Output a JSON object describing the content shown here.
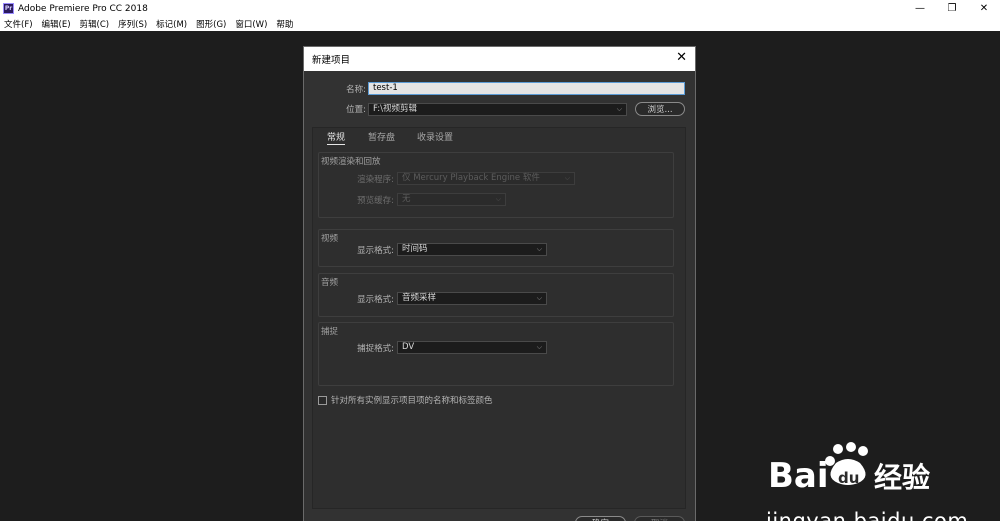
{
  "window": {
    "app_icon": "Pr",
    "title": "Adobe Premiere Pro CC 2018",
    "controls": {
      "minimize": "—",
      "restore": "❐",
      "close": "✕"
    }
  },
  "menu": [
    "文件(F)",
    "编辑(E)",
    "剪辑(C)",
    "序列(S)",
    "标记(M)",
    "图形(G)",
    "窗口(W)",
    "帮助"
  ],
  "dialog": {
    "title": "新建项目",
    "close": "✕",
    "name_label": "名称:",
    "name_value": "test-1",
    "location_label": "位置:",
    "location_value": "F:\\视频剪辑",
    "browse_label": "浏览...",
    "tabs": [
      "常规",
      "暂存盘",
      "收录设置"
    ],
    "groups": {
      "render": {
        "title": "视频渲染和回放",
        "renderer_label": "渲染程序:",
        "renderer_value": "仅 Mercury Playback Engine 软件",
        "preview_cache_label": "预览缓存:",
        "preview_cache_value": "无"
      },
      "video": {
        "title": "视频",
        "format_label": "显示格式:",
        "format_value": "时间码"
      },
      "audio": {
        "title": "音频",
        "format_label": "显示格式:",
        "format_value": "音频采样"
      },
      "capture": {
        "title": "捕捉",
        "format_label": "捕捉格式:",
        "format_value": "DV"
      }
    },
    "checkbox_label": "针对所有实例显示项目项的名称和标签颜色",
    "ok_label": "确定",
    "cancel_label": "取消"
  },
  "watermark": {
    "logo": "Bai 经验",
    "url": "jingyan.baidu.com"
  },
  "colors": {
    "accent": "#5b9bd5",
    "dialog_bg": "#323232",
    "workspace_bg": "#1d1d1d"
  }
}
